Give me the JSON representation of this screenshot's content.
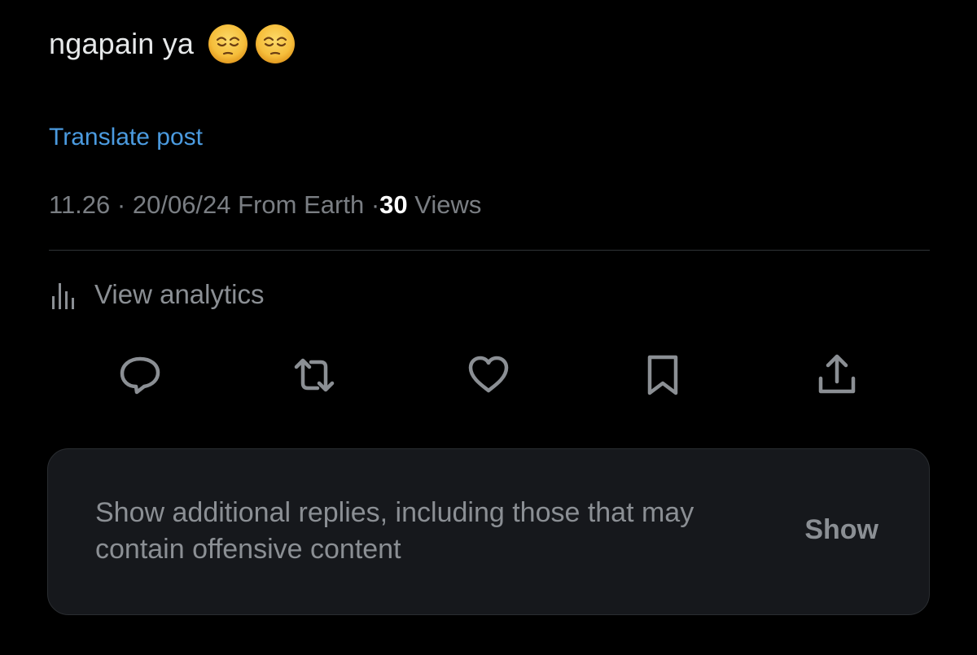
{
  "tweet": {
    "text": "ngapain ya",
    "emojis": [
      "pensive-face-emoji",
      "pensive-face-emoji"
    ]
  },
  "translate": {
    "label": "Translate post"
  },
  "meta": {
    "time": "11.26",
    "separator": "·",
    "date": "20/06/24",
    "location": "From Earth",
    "views_count": "30",
    "views_label": "Views"
  },
  "analytics": {
    "label": "View analytics",
    "icon": "bar-chart-icon"
  },
  "actions": [
    {
      "name": "reply",
      "icon": "reply-icon"
    },
    {
      "name": "repost",
      "icon": "repost-icon"
    },
    {
      "name": "like",
      "icon": "heart-icon"
    },
    {
      "name": "bookmark",
      "icon": "bookmark-icon"
    },
    {
      "name": "share",
      "icon": "share-icon"
    }
  ],
  "notice": {
    "message": "Show additional replies, including those that may contain offensive content",
    "button_label": "Show"
  },
  "colors": {
    "background": "#000000",
    "text": "#e7e9ea",
    "link": "#4b9be0",
    "muted": "#7a7e83",
    "icon": "#8b8f94",
    "card": "#16181c"
  }
}
